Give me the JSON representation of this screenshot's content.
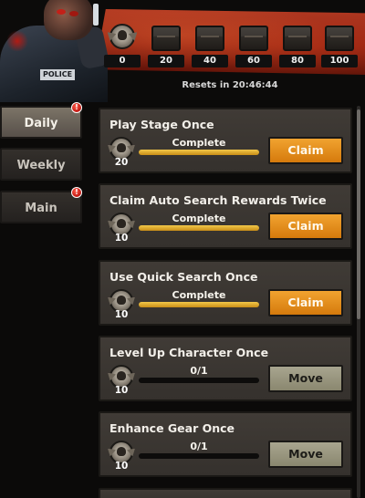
{
  "header": {
    "reset_text": "Resets in 20:46:44",
    "hero_badge": "POLICE"
  },
  "milestones": [
    {
      "value": "0",
      "icon": "skull-medal-icon"
    },
    {
      "value": "20",
      "icon": "chest-icon"
    },
    {
      "value": "40",
      "icon": "chest-icon"
    },
    {
      "value": "60",
      "icon": "chest-icon"
    },
    {
      "value": "80",
      "icon": "chest-icon"
    },
    {
      "value": "100",
      "icon": "chest-icon"
    }
  ],
  "tabs": [
    {
      "label": "Daily",
      "active": true,
      "alert": true
    },
    {
      "label": "Weekly",
      "active": false,
      "alert": false
    },
    {
      "label": "Main",
      "active": false,
      "alert": true
    }
  ],
  "quests": [
    {
      "title": "Play Stage Once",
      "reward": "20",
      "progress_text": "Complete",
      "progress": 1.0,
      "button": "Claim",
      "button_type": "claim"
    },
    {
      "title": "Claim Auto Search Rewards Twice",
      "reward": "10",
      "progress_text": "Complete",
      "progress": 1.0,
      "button": "Claim",
      "button_type": "claim"
    },
    {
      "title": "Use Quick Search Once",
      "reward": "10",
      "progress_text": "Complete",
      "progress": 1.0,
      "button": "Claim",
      "button_type": "claim"
    },
    {
      "title": "Level Up Character Once",
      "reward": "10",
      "progress_text": "0/1",
      "progress": 0.0,
      "button": "Move",
      "button_type": "move"
    },
    {
      "title": "Enhance Gear Once",
      "reward": "10",
      "progress_text": "0/1",
      "progress": 0.0,
      "button": "Move",
      "button_type": "move"
    }
  ],
  "colors": {
    "claim_button": "#e08d1a",
    "move_button": "#9b9880",
    "progress_fill": "#e2b035",
    "banner_red": "#a52d1b"
  }
}
